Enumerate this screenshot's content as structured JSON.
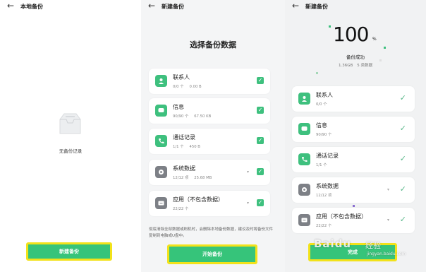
{
  "panel1": {
    "title": "本地备份",
    "empty_text": "无备份记录",
    "button": "新建备份"
  },
  "panel2": {
    "title": "新建备份",
    "heading": "选择备份数据",
    "items": [
      {
        "title": "联系人",
        "count": "0/0 个",
        "size": "0.00 B",
        "icon": "contact-icon"
      },
      {
        "title": "信息",
        "count": "90/90 个",
        "size": "67.50 KB",
        "icon": "message-icon"
      },
      {
        "title": "通话记录",
        "count": "1/1 个",
        "size": "450 B",
        "icon": "phone-icon"
      },
      {
        "title": "系统数据",
        "count": "12/12 项",
        "size": "25.68 MB",
        "icon": "gear-icon"
      },
      {
        "title": "应用（不包含数据）",
        "count": "22/22 个",
        "size": "",
        "icon": "app-icon"
      }
    ],
    "note": "彻底清除全部数据或刷机时，会删除本地备份数据，建议及时将备份文件复制到电脑或U盘中。",
    "button": "开始备份"
  },
  "panel3": {
    "title": "新建备份",
    "percent": "100",
    "percent_sign": "%",
    "success": "备份成功",
    "size": "1.36GB",
    "items_count": "5 类数据",
    "items": [
      {
        "title": "联系人",
        "count": "0/0 个",
        "icon": "contact-icon"
      },
      {
        "title": "信息",
        "count": "90/90 个",
        "icon": "message-icon"
      },
      {
        "title": "通话记录",
        "count": "1/1 个",
        "icon": "phone-icon"
      },
      {
        "title": "系统数据",
        "count": "12/12 项",
        "icon": "gear-icon"
      },
      {
        "title": "应用（不包含数据）",
        "count": "22/22 个",
        "icon": "app-icon"
      }
    ],
    "button": "完成"
  },
  "watermark": {
    "text": "Baidu",
    "text2": "经验",
    "text3": "jingyan.baidu.com"
  },
  "colors": {
    "accent": "#36c47a",
    "highlight_border": "#f2e21a"
  }
}
